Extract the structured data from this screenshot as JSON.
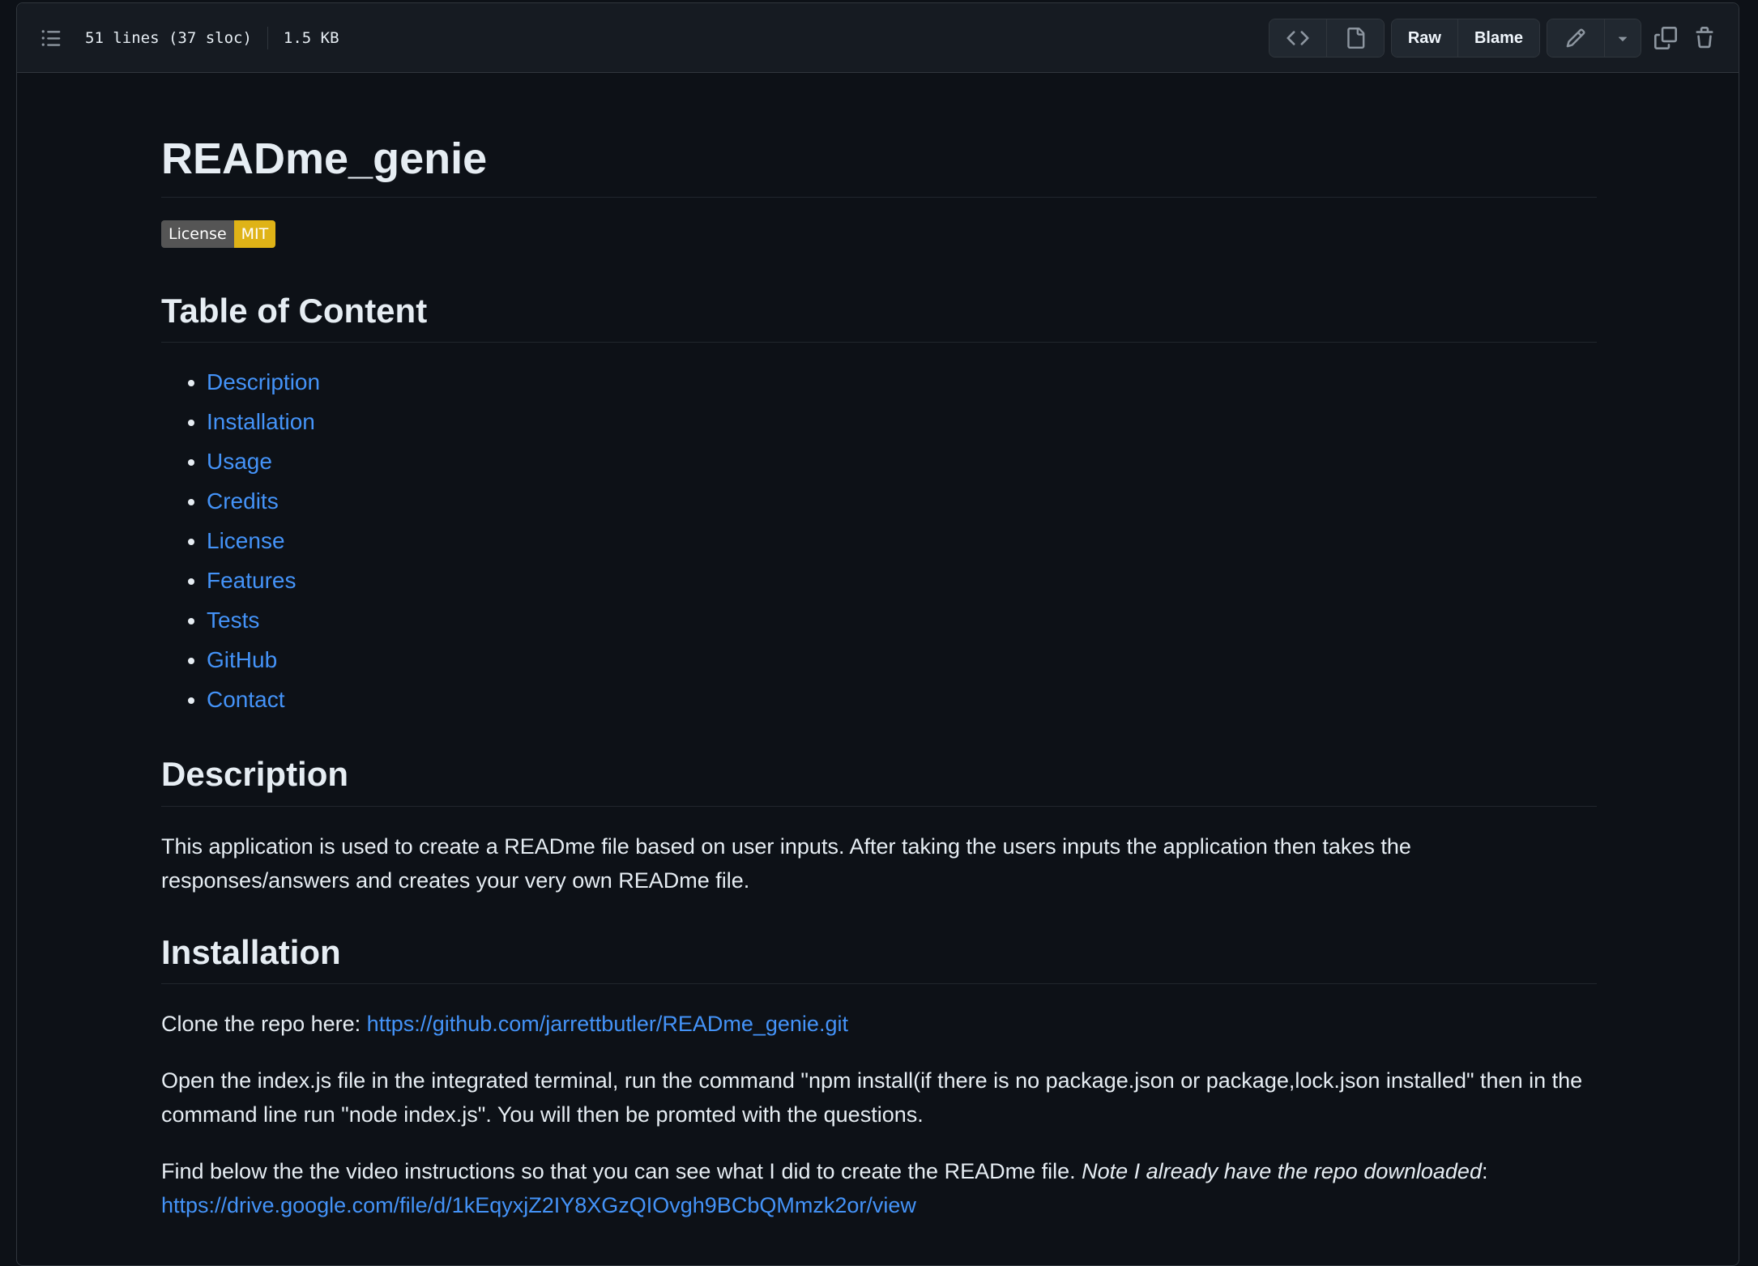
{
  "toolbar": {
    "line_info": "51 lines (37 sloc)",
    "file_size": "1.5 KB",
    "raw_label": "Raw",
    "blame_label": "Blame"
  },
  "readme": {
    "title": "READme_genie",
    "badge": {
      "label": "License",
      "value": "MIT",
      "value_color": "#dfb317"
    },
    "toc_heading": "Table of Content",
    "toc_items": [
      "Description",
      "Installation",
      "Usage",
      "Credits",
      "License",
      "Features",
      "Tests",
      "GitHub",
      "Contact"
    ],
    "description_heading": "Description",
    "description_text": "This application is used to create a READme file based on user inputs. After taking the users inputs the application then takes the responses/answers and creates your very own READme file.",
    "installation_heading": "Installation",
    "clone_text": "Clone the repo here: ",
    "clone_link": "https://github.com/jarrettbutler/READme_genie.git",
    "open_text": "Open the index.js file in the integrated terminal, run the command \"npm install(if there is no package.json or package,lock.json installed\" then in the command line run \"node index.js\". You will then be promted with the questions.",
    "video_text": "Find below the the video instructions so that you can see what I did to create the READme file. ",
    "video_note": "Note I already have the repo downloaded",
    "video_colon": ":",
    "video_link": "https://drive.google.com/file/d/1kEqyxjZ2IY8XGzQIOvgh9BCbQMmzk2or/view"
  },
  "colors": {
    "background": "#0d1117",
    "link": "#4493f8",
    "border": "#30363d"
  }
}
